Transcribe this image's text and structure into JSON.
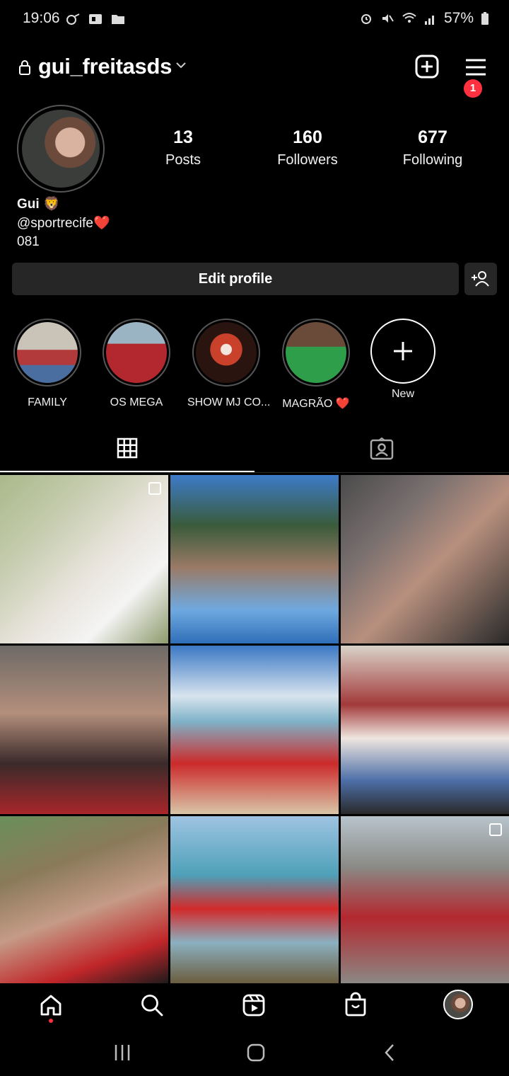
{
  "status_bar": {
    "time": "19:06",
    "battery": "57%"
  },
  "header": {
    "username": "gui_freitasds",
    "notification_count": "1"
  },
  "profile": {
    "stats": [
      {
        "value": "13",
        "label": "Posts"
      },
      {
        "value": "160",
        "label": "Followers"
      },
      {
        "value": "677",
        "label": "Following"
      }
    ],
    "name": "Gui 🦁",
    "bio_line1": "@sportrecife❤️",
    "bio_line2": "081",
    "edit_label": "Edit profile"
  },
  "highlights": [
    {
      "label": "FAMILY"
    },
    {
      "label": "OS MEGA"
    },
    {
      "label": "SHOW MJ CO..."
    },
    {
      "label": "MAGRÃO ❤️"
    },
    {
      "label": "New"
    }
  ],
  "grid": {
    "posts": [
      {
        "description": "portrait outdoors white shirt",
        "multi": true
      },
      {
        "description": "selfie palm trees",
        "multi": false
      },
      {
        "description": "selfie rocks",
        "multi": false
      },
      {
        "description": "selfie red plaid shirt",
        "multi": false
      },
      {
        "description": "beach red shirt",
        "multi": false
      },
      {
        "description": "family group sofa",
        "multi": false
      },
      {
        "description": "stadium selfie",
        "multi": false
      },
      {
        "description": "beach standing",
        "multi": false
      },
      {
        "description": "large group red shirts",
        "multi": true
      }
    ]
  },
  "colors": {
    "accent_badge": "#ff3040",
    "button_bg": "#262626",
    "background": "#000000"
  }
}
